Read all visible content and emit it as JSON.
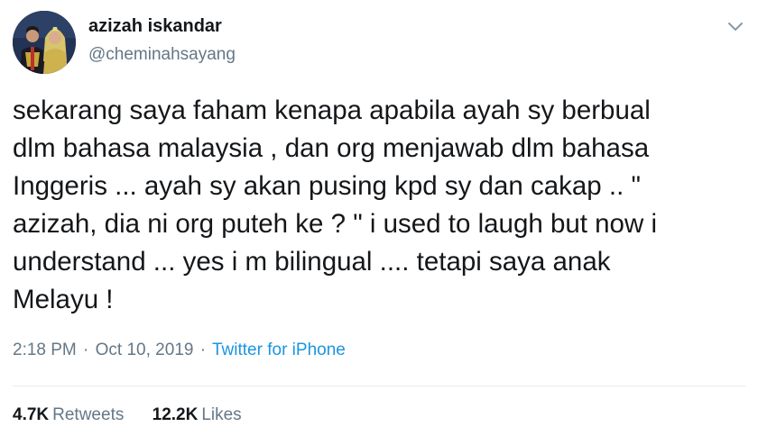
{
  "user": {
    "name": "azizah iskandar",
    "handle": "@cheminahsayang"
  },
  "tweet": {
    "text": "sekarang saya faham kenapa apabila ayah sy berbual\ndlm bahasa malaysia , dan org menjawab dlm bahasa\nInggeris ... ayah sy akan pusing kpd sy dan cakap .. \"\nazizah, dia ni org puteh ke ? \" i used to laugh but now i\nunderstand ... yes i m bilingual .... tetapi saya anak\nMelayu !",
    "time": "2:18 PM",
    "date": "Oct 10, 2019",
    "separator": "·",
    "source": "Twitter for iPhone"
  },
  "stats": {
    "retweets_count": "4.7K",
    "retweets_label": "Retweets",
    "likes_count": "12.2K",
    "likes_label": "Likes"
  },
  "icons": {
    "menu": "chevron-down-icon",
    "avatar": "profile-photo"
  },
  "colors": {
    "text": "#14171a",
    "secondary": "#657786",
    "link": "#1b95e0",
    "divider": "#e6ecf0"
  }
}
